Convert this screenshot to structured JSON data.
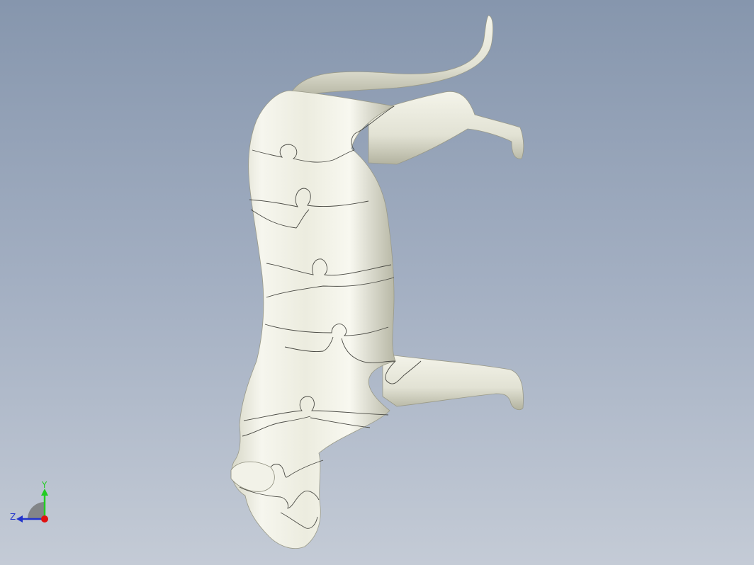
{
  "viewport": {
    "model_name": "",
    "colors": {
      "background_top": "#8696ad",
      "background_bottom": "#c4cbd6",
      "model_surface": "#e8e8dc",
      "model_shadow": "#b9b9a8",
      "seam_lines": "#4a4a44"
    }
  },
  "triad": {
    "y_label": "Y",
    "z_label": "Z",
    "colors": {
      "y_axis": "#22cc22",
      "z_axis": "#2233cc",
      "x_axis": "#e01010"
    }
  }
}
